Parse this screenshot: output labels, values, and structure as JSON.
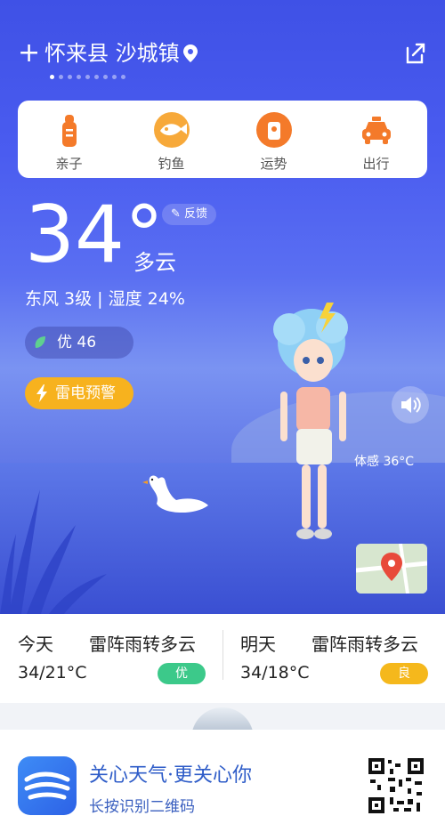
{
  "header": {
    "location": "怀来县 沙城镇",
    "page_dots": 9,
    "active_dot": 0
  },
  "quick_tiles": [
    {
      "label": "亲子",
      "icon": "baby-bottle-icon",
      "color": "#f47a2a"
    },
    {
      "label": "钓鱼",
      "icon": "fish-icon",
      "color": "#f7a93a"
    },
    {
      "label": "运势",
      "icon": "fortune-icon",
      "color": "#f47a2a"
    },
    {
      "label": "出行",
      "icon": "taxi-icon",
      "color": "#f47a2a"
    }
  ],
  "weather": {
    "temperature": "34°",
    "condition": "多云",
    "feedback_label": "反馈",
    "wind_humidity": "东风 3级 | 湿度 24%",
    "aqi": "优 46",
    "warning": "雷电预警",
    "feels_like": "体感 36°C"
  },
  "forecast": [
    {
      "day": "今天",
      "condition": "雷阵雨转多云",
      "temps": "34/21°C",
      "quality": "优",
      "quality_color": "#3cc98a"
    },
    {
      "day": "明天",
      "condition": "雷阵雨转多云",
      "temps": "34/18°C",
      "quality": "良",
      "quality_color": "#f5b81c"
    }
  ],
  "promo": {
    "title": "关心天气·更关心你",
    "subtitle": "长按识别二维码"
  },
  "colors": {
    "accent": "#3f51e6",
    "warning": "#f7b21e"
  }
}
